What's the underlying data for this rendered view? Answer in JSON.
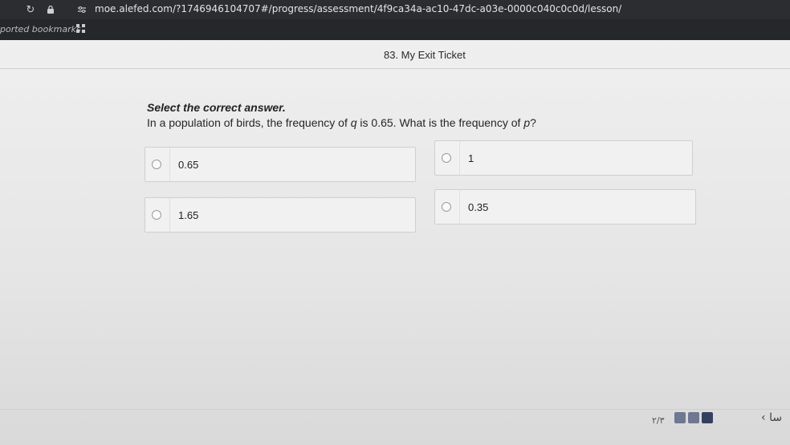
{
  "browser": {
    "url": "moe.alefed.com/?1746946104707#/progress/assessment/4f9ca34a-ac10-47dc-a03e-0000c040c0c0d/lesson/",
    "bookmarks_label": "ported bookmarks"
  },
  "header": {
    "back_label": "",
    "title": "83. My Exit Ticket"
  },
  "question": {
    "prompt": "Select the correct answer.",
    "text_before": "In a population of birds, the frequency of ",
    "var_q": "q",
    "text_middle": " is 0.65. What is the frequency of ",
    "var_p": "p",
    "text_after": "?"
  },
  "options": [
    {
      "label": "0.65"
    },
    {
      "label": "1"
    },
    {
      "label": "1.65"
    },
    {
      "label": "0.35"
    }
  ],
  "footer": {
    "page_counter": "٢/٣",
    "prev_label": "‹ ﺳﺎ"
  }
}
